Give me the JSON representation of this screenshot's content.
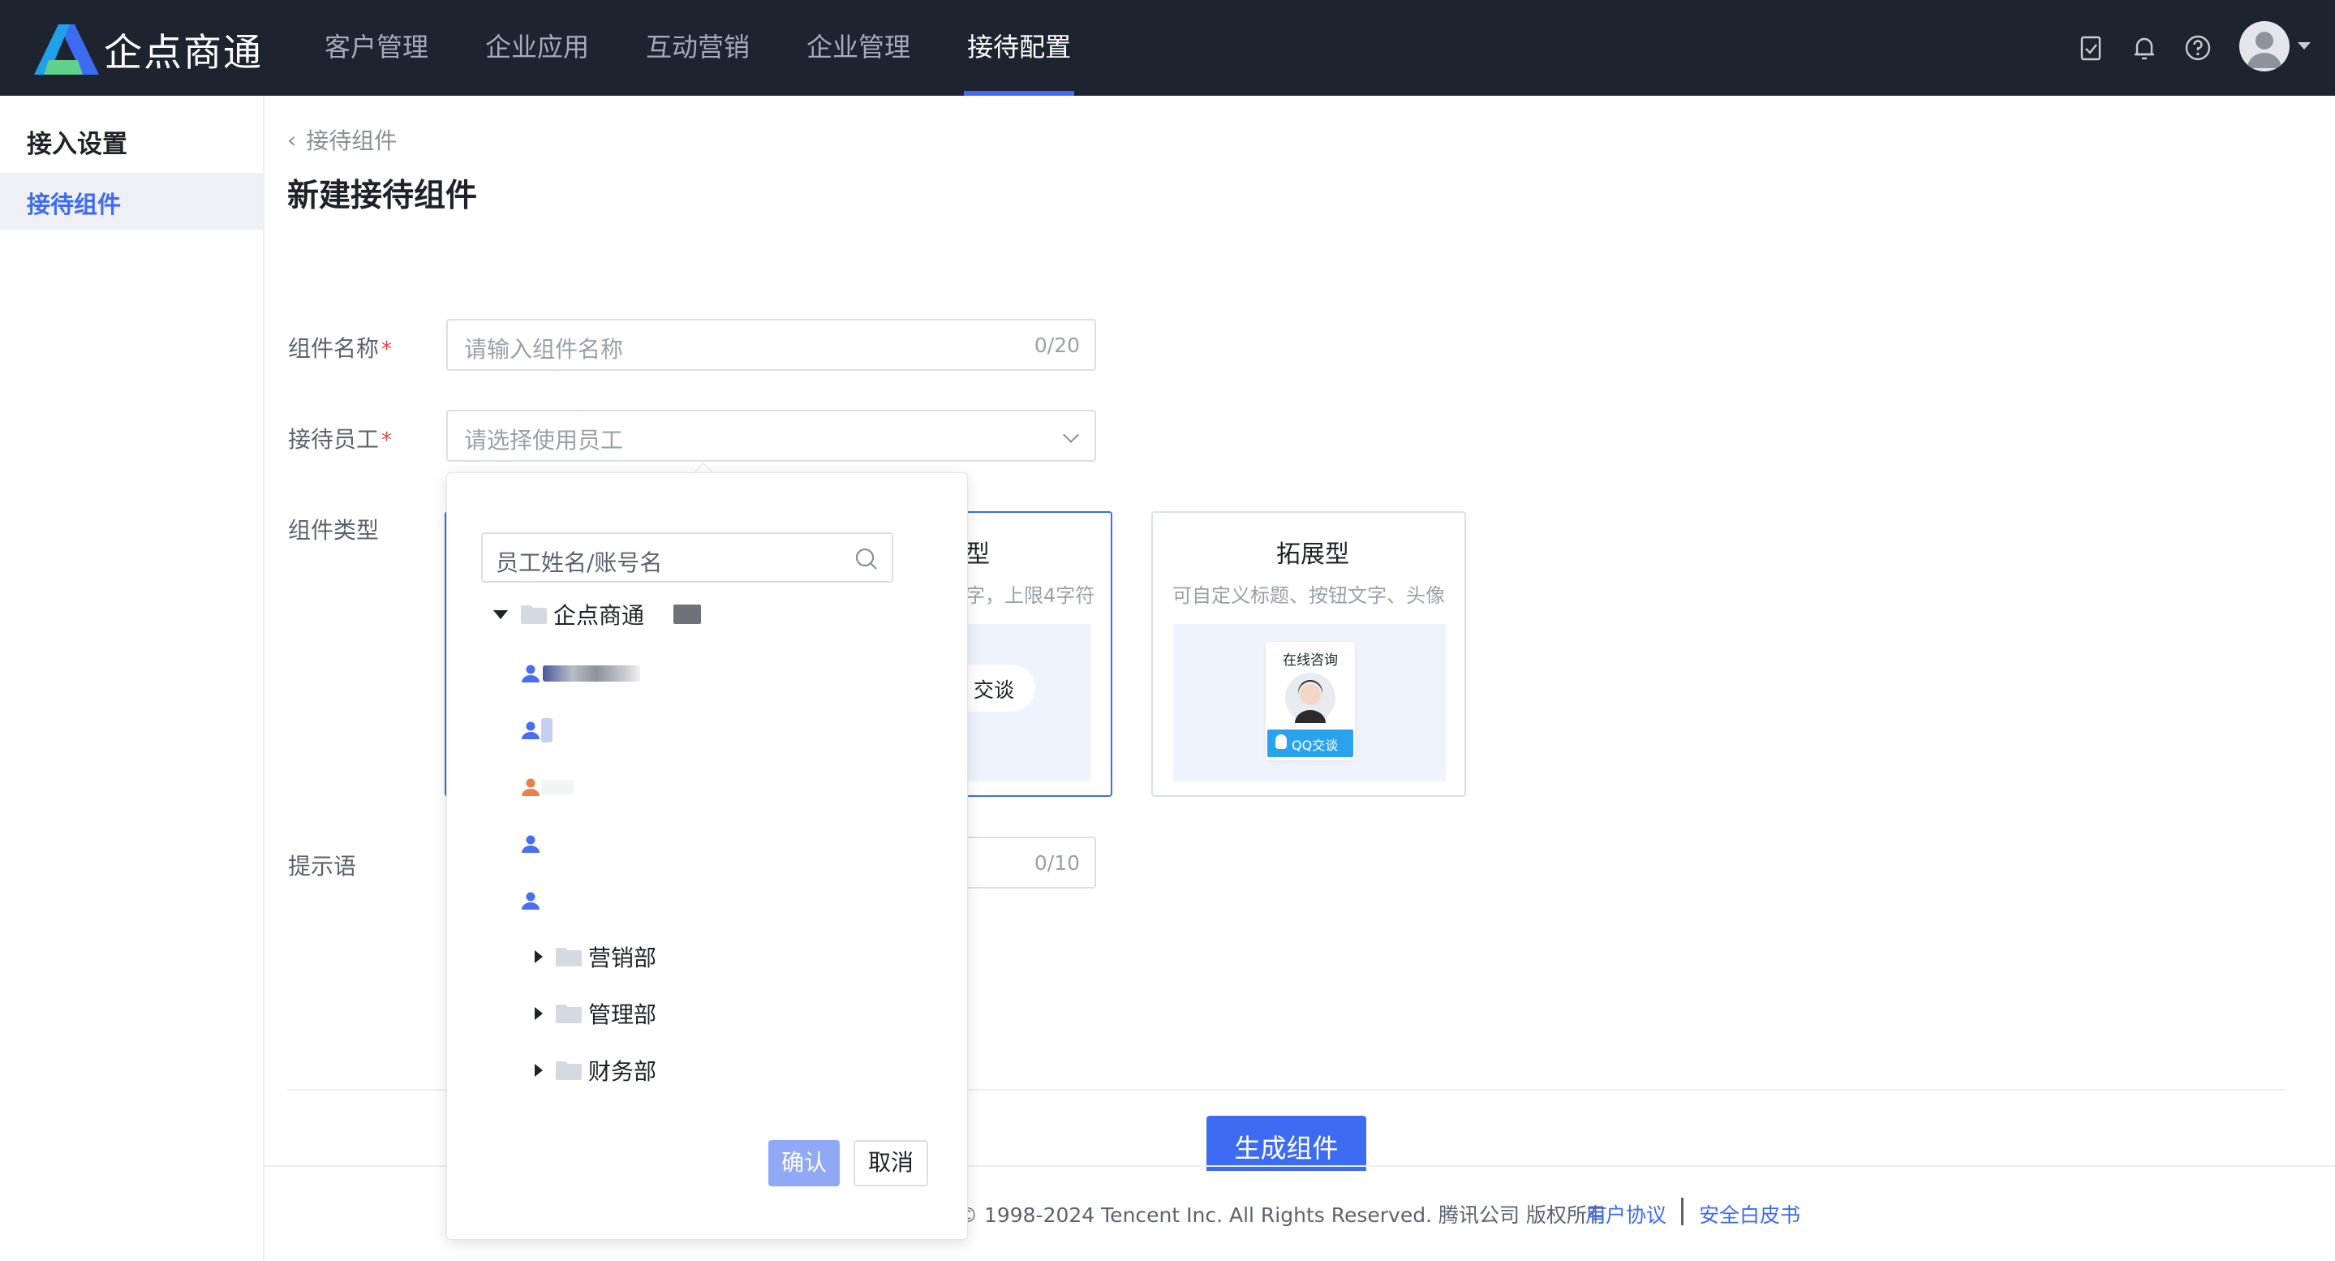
{
  "brand": "企点商通",
  "nav": [
    {
      "label": "客户管理",
      "active": false
    },
    {
      "label": "企业应用",
      "active": false
    },
    {
      "label": "互动营销",
      "active": false
    },
    {
      "label": "企业管理",
      "active": false
    },
    {
      "label": "接待配置",
      "active": true
    }
  ],
  "topbar_icons": [
    "task-check-icon",
    "bell-icon",
    "help-icon"
  ],
  "sidebar": {
    "title": "接入设置",
    "items": [
      {
        "label": "接待组件",
        "active": true
      }
    ]
  },
  "breadcrumb": "接待组件",
  "page_title": "新建接待组件",
  "form": {
    "name": {
      "label": "组件名称",
      "placeholder": "请输入组件名称",
      "count": "0/20",
      "required": "*"
    },
    "staff": {
      "label": "接待员工",
      "placeholder": "请选择使用员工",
      "required": "*"
    },
    "type": {
      "label": "组件类型"
    },
    "tip": {
      "label": "提示语",
      "count": "0/10"
    }
  },
  "cards": [
    {
      "title": "型",
      "desc": "字，上限4字符",
      "button_text": "交谈"
    },
    {
      "title": "拓展型",
      "desc": "可自定义标题、按钮文字、头像",
      "preview_title": "在线咨询",
      "preview_button": "QQ交谈"
    }
  ],
  "generate_button": "生成组件",
  "dropdown": {
    "search_placeholder": "员工姓名/账号名",
    "root": "企点商通",
    "departments": [
      "营销部",
      "管理部",
      "财务部"
    ],
    "confirm": "确认",
    "cancel": "取消"
  },
  "footer": {
    "copyright": "© 1998-2024 Tencent Inc. All Rights Reserved. 腾讯公司 版权所有",
    "links": [
      "用户协议",
      "安全白皮书"
    ]
  },
  "colors": {
    "accent": "#3d6cf2",
    "topbar": "#1e2330",
    "required": "#e54545"
  }
}
